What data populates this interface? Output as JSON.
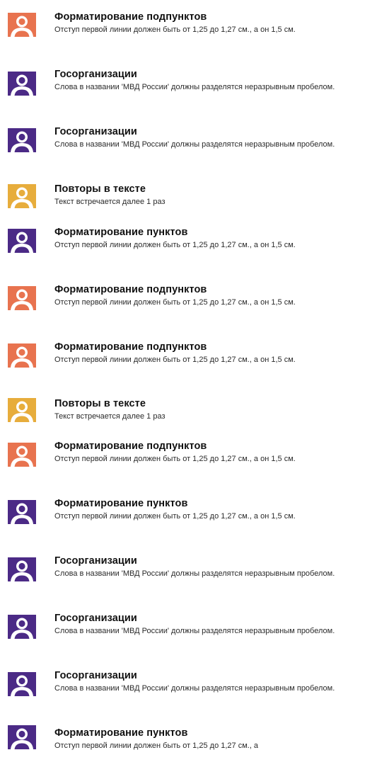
{
  "colors": {
    "orange": "#e8734f",
    "purple": "#4b2a86",
    "yellow": "#e7ad3c"
  },
  "items": [
    {
      "title": "Форматирование подпунктов",
      "desc": "Отступ первой линии должен быть от 1,25 до 1,27 см., а он 1,5 см.",
      "color": "#e8734f"
    },
    {
      "title": "Госорганизации",
      "desc": "Слова в названии 'МВД России' должны разделятся неразрывным пробелом.",
      "color": "#4b2a86"
    },
    {
      "title": "Госорганизации",
      "desc": "Слова в названии 'МВД России' должны разделятся неразрывным пробелом.",
      "color": "#4b2a86"
    },
    {
      "title": "Повторы в тексте",
      "desc": "Текст встречается далее 1 раз",
      "color": "#e7ad3c"
    },
    {
      "title": "Форматирование пунктов",
      "desc": "Отступ первой линии должен быть от 1,25 до 1,27 см., а он 1,5 см.",
      "color": "#4b2a86"
    },
    {
      "title": "Форматирование подпунктов",
      "desc": "Отступ первой линии должен быть от 1,25 до 1,27 см., а он 1,5 см.",
      "color": "#e8734f"
    },
    {
      "title": "Форматирование подпунктов",
      "desc": "Отступ первой линии должен быть от 1,25 до 1,27 см., а он 1,5 см.",
      "color": "#e8734f"
    },
    {
      "title": "Повторы в тексте",
      "desc": "Текст встречается далее 1 раз",
      "color": "#e7ad3c"
    },
    {
      "title": "Форматирование подпунктов",
      "desc": "Отступ первой линии должен быть от 1,25 до 1,27 см., а он 1,5 см.",
      "color": "#e8734f"
    },
    {
      "title": "Форматирование пунктов",
      "desc": "Отступ первой линии должен быть от 1,25 до 1,27 см., а он 1,5 см.",
      "color": "#4b2a86"
    },
    {
      "title": "Госорганизации",
      "desc": "Слова в названии 'МВД России' должны разделятся неразрывным пробелом.",
      "color": "#4b2a86"
    },
    {
      "title": "Госорганизации",
      "desc": "Слова в названии 'МВД России' должны разделятся неразрывным пробелом.",
      "color": "#4b2a86"
    },
    {
      "title": "Госорганизации",
      "desc": "Слова в названии 'МВД России' должны разделятся неразрывным пробелом.",
      "color": "#4b2a86"
    },
    {
      "title": "Форматирование пунктов",
      "desc": "Отступ первой линии должен быть от 1,25 до 1,27 см., а",
      "color": "#4b2a86"
    }
  ]
}
